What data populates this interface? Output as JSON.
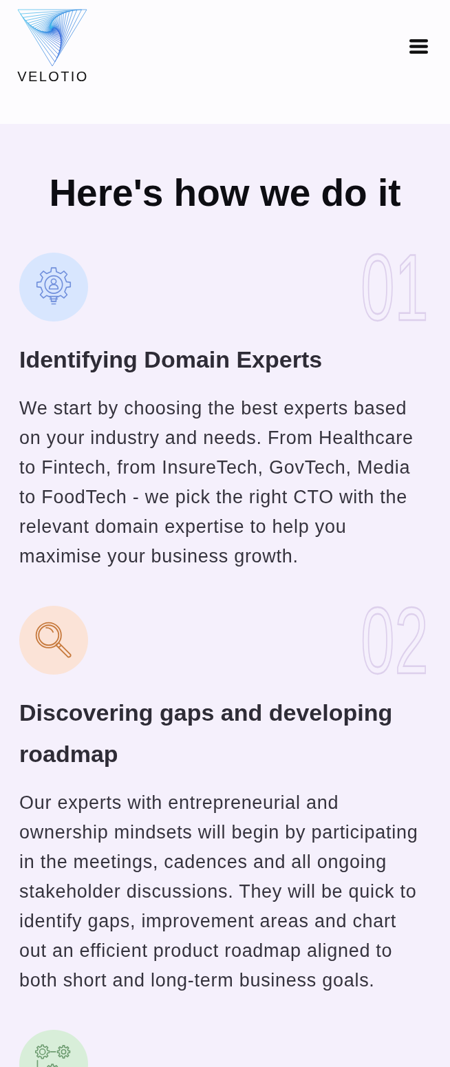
{
  "header": {
    "brand": "VELOTIO"
  },
  "section": {
    "title": "Here's how we do it"
  },
  "steps": [
    {
      "kind": "gear-person",
      "number": "01",
      "heading": "Identifying Domain Experts",
      "text": "We start by choosing the best experts based on your industry and needs. From Healthcare to Fintech, from InsureTech, GovTech, Media to FoodTech - we pick the right CTO with the relevant domain expertise to help you maximise your business growth."
    },
    {
      "kind": "magnifier",
      "number": "02",
      "heading": "Discovering gaps and developing roadmap",
      "text": "Our experts with entrepreneurial and ownership mindsets will begin by participating in the meetings, cadences and all ongoing stakeholder discussions. They will be quick to identify gaps, improvement areas and chart out an efficient product roadmap aligned to both short and long-term business goals."
    },
    {
      "kind": "gears"
    }
  ]
}
